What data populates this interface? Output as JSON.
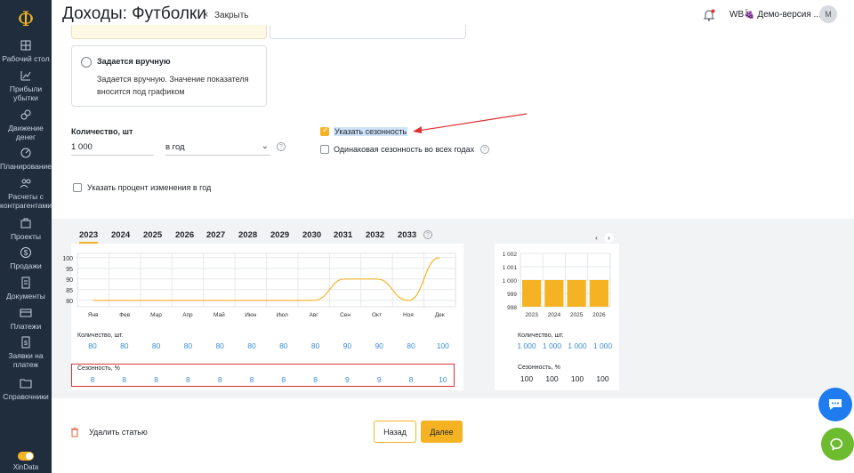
{
  "header": {
    "title": "Доходы: Футболки",
    "close_icon": "×",
    "close_label": "Закрыть",
    "account": "WB🍇 Демо-версия ...",
    "avatar": "M"
  },
  "sidebar": {
    "logo": "Ф",
    "items": [
      {
        "label": "Рабочий стол",
        "icon": "desktop-icon"
      },
      {
        "label": "Прибыли убытки",
        "icon": "chart-icon"
      },
      {
        "label": "Движение денег",
        "icon": "cashflow-icon"
      },
      {
        "label": "Планирование",
        "icon": "planning-icon"
      },
      {
        "label": "Расчеты с контрагентами",
        "icon": "contractors-icon"
      },
      {
        "label": "Проекты",
        "icon": "projects-icon"
      },
      {
        "label": "Продажи",
        "icon": "sales-icon"
      },
      {
        "label": "Документы",
        "icon": "documents-icon"
      },
      {
        "label": "Платежи",
        "icon": "payments-icon"
      },
      {
        "label": "Заявки на платеж",
        "icon": "requests-icon"
      },
      {
        "label": "Справочники",
        "icon": "folder-icon"
      }
    ],
    "brand": "XinData"
  },
  "manual_card": {
    "title": "Задается вручную",
    "desc": "Задается вручную. Значение показателя вносится под графиком"
  },
  "quantity": {
    "label": "Количество, шт",
    "value": "1 000",
    "period": "в год",
    "help": "?"
  },
  "options": {
    "seasonality": {
      "label": "Указать сезонность",
      "checked": true
    },
    "same_seasonality": {
      "label": "Одинаковая сезонность во всех годах",
      "checked": false
    },
    "percent_change": {
      "label": "Указать процент изменения в год",
      "checked": false
    }
  },
  "years": {
    "tabs": [
      "2023",
      "2024",
      "2025",
      "2026",
      "2027",
      "2028",
      "2029",
      "2030",
      "2031",
      "2032",
      "2033"
    ],
    "active": 0,
    "help": "?",
    "prev": "‹",
    "next": "›"
  },
  "chart_data": [
    {
      "type": "line",
      "x": [
        "Янв",
        "Фев",
        "Мар",
        "Апр",
        "Май",
        "Июн",
        "Июл",
        "Авг",
        "Сен",
        "Окт",
        "Ноя",
        "Дек"
      ],
      "series": [
        {
          "values": [
            80,
            80,
            80,
            80,
            80,
            80,
            80,
            80,
            90,
            90,
            80,
            100
          ]
        }
      ],
      "yticks": [
        80,
        85,
        90,
        95,
        100
      ],
      "ylim": [
        77,
        102
      ],
      "grid": true,
      "color": "#f5b324"
    },
    {
      "type": "bar",
      "categories": [
        "2023",
        "2024",
        "2025",
        "2026"
      ],
      "values": [
        1000,
        1000,
        1000,
        1000
      ],
      "yticks": [
        "998",
        "999",
        "1 000",
        "1 001",
        "1 002"
      ],
      "ylim": [
        998,
        1002
      ],
      "grid": true,
      "color": "#f5b324"
    }
  ],
  "monthly_table": {
    "qty_label": "Количество, шт.",
    "qty": [
      "80",
      "80",
      "80",
      "80",
      "80",
      "80",
      "80",
      "80",
      "90",
      "90",
      "80",
      "100"
    ],
    "season_label": "Сезонность, %",
    "season": [
      "8",
      "8",
      "8",
      "8",
      "8",
      "8",
      "8",
      "8",
      "9",
      "9",
      "8",
      "10"
    ]
  },
  "yearly_table": {
    "qty_label": "Количество, шт.",
    "qty": [
      "1 000",
      "1 000",
      "1 000",
      "1 000"
    ],
    "season_label": "Сезонность, %",
    "season": [
      "100",
      "100",
      "100",
      "100"
    ]
  },
  "footer": {
    "delete_label": "Удалить статью",
    "back_label": "Назад",
    "next_label": "Далее"
  }
}
